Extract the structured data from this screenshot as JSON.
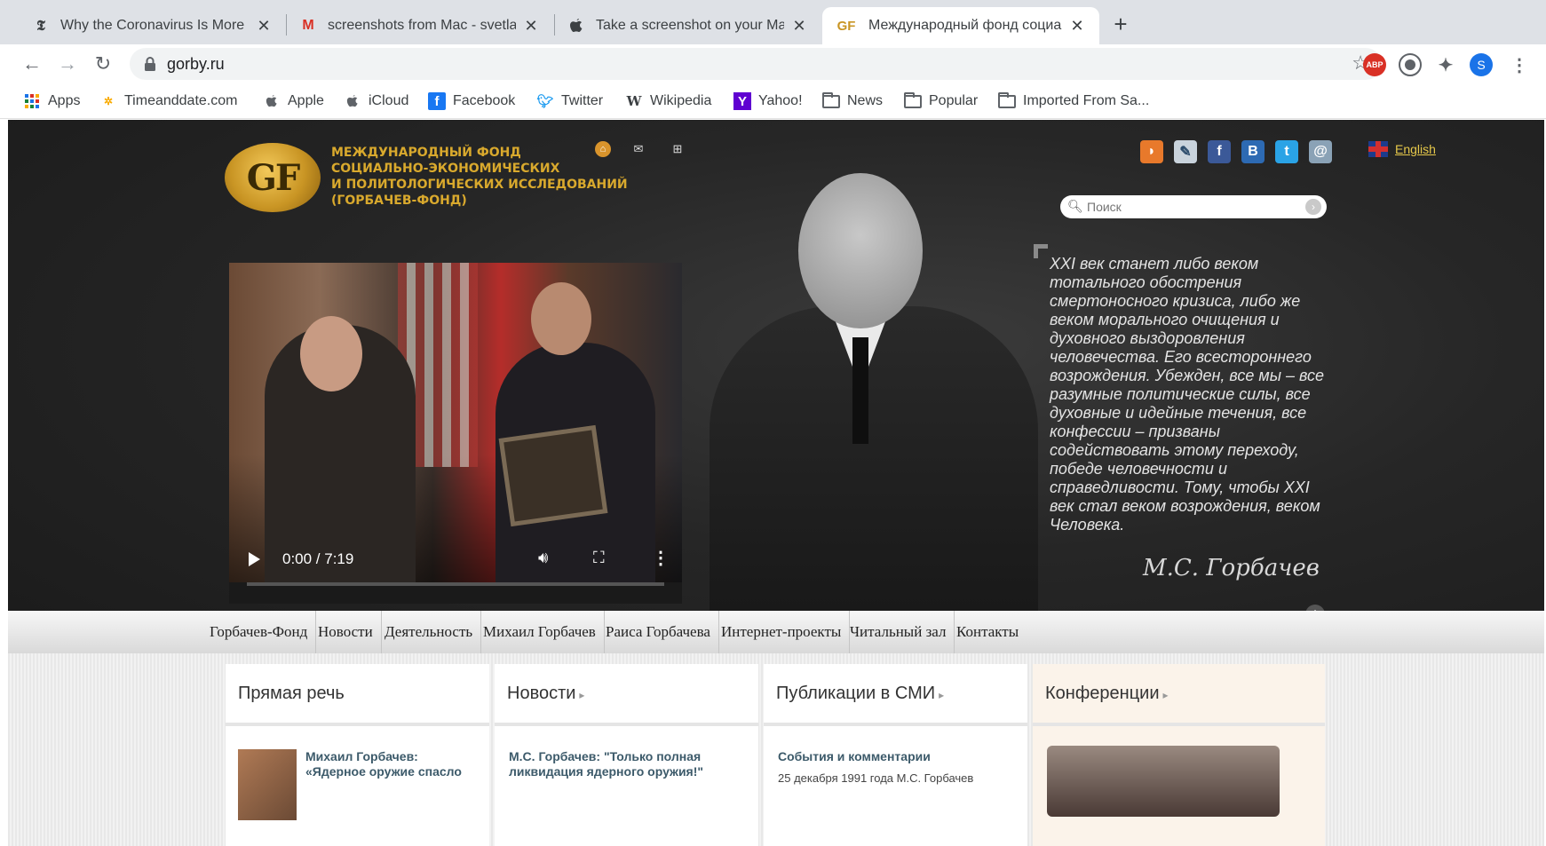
{
  "tabs": [
    {
      "title": "Why the Coronavirus Is More Li",
      "favicon": "nyt-icon"
    },
    {
      "title": "screenshots from Mac - svetlan",
      "favicon": "gmail-icon"
    },
    {
      "title": "Take a screenshot on your Mac",
      "favicon": "apple-icon"
    },
    {
      "title": "Международный фонд социа",
      "favicon": "gf-icon",
      "active": true
    }
  ],
  "omnibox": {
    "url": "gorby.ru"
  },
  "bookmarks": [
    {
      "label": "Apps",
      "icon": "apps-grid-icon"
    },
    {
      "label": "Timeanddate.com",
      "icon": "timeanddate-icon"
    },
    {
      "label": "Apple",
      "icon": "apple-icon"
    },
    {
      "label": "iCloud",
      "icon": "apple-icon"
    },
    {
      "label": "Facebook",
      "icon": "facebook-icon"
    },
    {
      "label": "Twitter",
      "icon": "twitter-icon"
    },
    {
      "label": "Wikipedia",
      "icon": "wikipedia-icon"
    },
    {
      "label": "Yahoo!",
      "icon": "yahoo-icon"
    },
    {
      "label": "News",
      "icon": "folder-icon"
    },
    {
      "label": "Popular",
      "icon": "folder-icon"
    },
    {
      "label": "Imported From Sa...",
      "icon": "folder-icon"
    }
  ],
  "extensions": {
    "abp": "ABP",
    "profile": "S"
  },
  "site": {
    "logo_mark": "GF",
    "logo_lines": [
      "МЕЖДУНАРОДНЫЙ ФОНД",
      "СОЦИАЛЬНО-ЭКОНОМИЧЕСКИХ",
      "И ПОЛИТОЛОГИЧЕСКИХ ИССЛЕДОВАНИЙ",
      "(ГОРБАЧЕВ-ФОНД)"
    ],
    "language_link": "English",
    "search_placeholder": "Поиск",
    "video": {
      "time": "0:00 / 7:19"
    },
    "quote": "XXI век станет либо веком тотального обострения смертоносного кризиса, либо же веком морального очищения и духовного выздоровления человечества. Его всестороннего возрождения. Убежден, все мы – все разумные политические силы, все духовные и идейные течения, все конфессии – призваны содействовать этому переходу, победе человечности и справедливости. Тому, чтобы XXI век стал веком возрождения, веком Человека.",
    "signature": "М.С. Горбачев",
    "social": [
      "rss-icon",
      "livejournal-icon",
      "facebook-icon",
      "vk-icon",
      "twitter-icon",
      "email-icon"
    ],
    "nav": [
      "Горбачев-Фонд",
      "Новости",
      "Деятельность",
      "Михаил Горбачев",
      "Раиса Горбачева",
      "Интернет-проекты",
      "Читальный зал",
      "Контакты"
    ],
    "columns": [
      {
        "title": "Прямая речь",
        "item_title": "Михаил Горбачев: «Ядерное оружие спасло",
        "item_sub": ""
      },
      {
        "title": "Новости",
        "item_title": "М.С. Горбачев: \"Только полная ликвидация ядерного оружия!\"",
        "item_sub": ""
      },
      {
        "title": "Публикации в СМИ",
        "item_title": "События и комментарии",
        "item_sub": "25 декабря 1991 года М.С. Горбачев"
      },
      {
        "title": "Конференции",
        "item_title": "",
        "item_sub": ""
      }
    ]
  }
}
